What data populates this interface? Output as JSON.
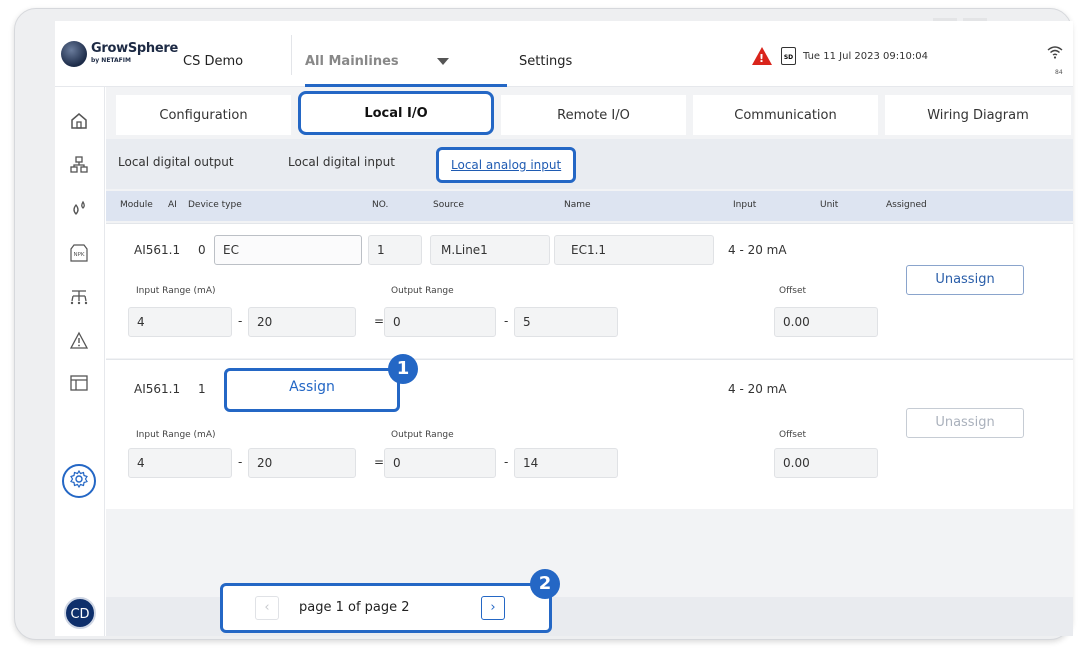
{
  "header": {
    "brand": "GrowSphere",
    "brand_sub": "by NETAFIM",
    "site": "CS Demo",
    "mainline": "All Mainlines",
    "settings": "Settings",
    "sd_label": "SD",
    "datetime": "Tue 11 Jul 2023  09:10:04",
    "wifi_strength": "84"
  },
  "sidebar": {
    "icons": [
      "home-icon",
      "network-icon",
      "water-drops-icon",
      "npk-icon",
      "irrigation-icon",
      "alert-icon",
      "layout-icon",
      "settings-icon"
    ],
    "npk_label": "NPK",
    "user_initials": "CD"
  },
  "tabs": [
    "Configuration",
    "Local I/O",
    "Remote I/O",
    "Communication",
    "Wiring Diagram"
  ],
  "subtabs": [
    "Local digital output",
    "Local digital input",
    "Local analog input"
  ],
  "table": {
    "headers": [
      "Module",
      "AI",
      "Device type",
      "NO.",
      "Source",
      "Name",
      "Input",
      "Unit",
      "Assigned"
    ],
    "rows": [
      {
        "module": "AI561.1",
        "ai": "0",
        "device_type": "EC",
        "no": "1",
        "source": "M.Line1",
        "name": "EC1.1",
        "input": "4 - 20 mA",
        "input_range_label": "Input Range (mA)",
        "input_min": "4",
        "input_max": "20",
        "output_range_label": "Output Range",
        "output_min": "0",
        "output_max": "5",
        "offset_label": "Offset",
        "offset": "0.00",
        "action": "Unassign"
      },
      {
        "module": "AI561.1",
        "ai": "1",
        "assign_label": "Assign",
        "input": "4 - 20 mA",
        "input_range_label": "Input Range (mA)",
        "input_min": "4",
        "input_max": "20",
        "output_range_label": "Output Range",
        "output_min": "0",
        "output_max": "14",
        "offset_label": "Offset",
        "offset": "0.00",
        "action": "Unassign"
      }
    ]
  },
  "range_dash": "-",
  "range_equals": "=",
  "pager": {
    "text": "page 1 of page 2",
    "prev": "‹",
    "next": "›"
  },
  "callouts": [
    "1",
    "2"
  ],
  "accent_color": "#2467c5",
  "alert_color": "#d9241b"
}
